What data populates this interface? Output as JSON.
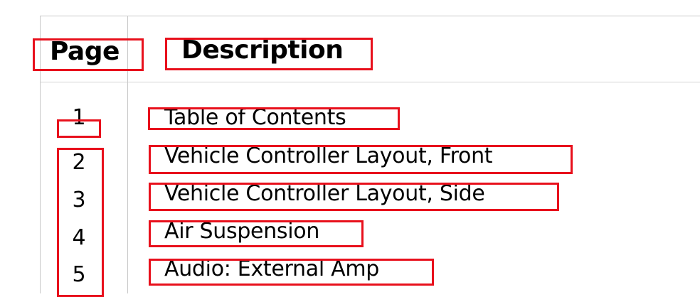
{
  "table": {
    "headers": {
      "page": "Page",
      "description": "Description"
    },
    "rows": [
      {
        "page": "1",
        "description": "Table of Contents"
      },
      {
        "page": "2",
        "description": "Vehicle Controller Layout, Front"
      },
      {
        "page": "3",
        "description": "Vehicle Controller Layout, Side"
      },
      {
        "page": "4",
        "description": "Air Suspension"
      },
      {
        "page": "5",
        "description": "Audio: External Amp"
      }
    ]
  },
  "colors": {
    "highlight_box": "#e8101c",
    "grid": "#c8c8c8"
  }
}
